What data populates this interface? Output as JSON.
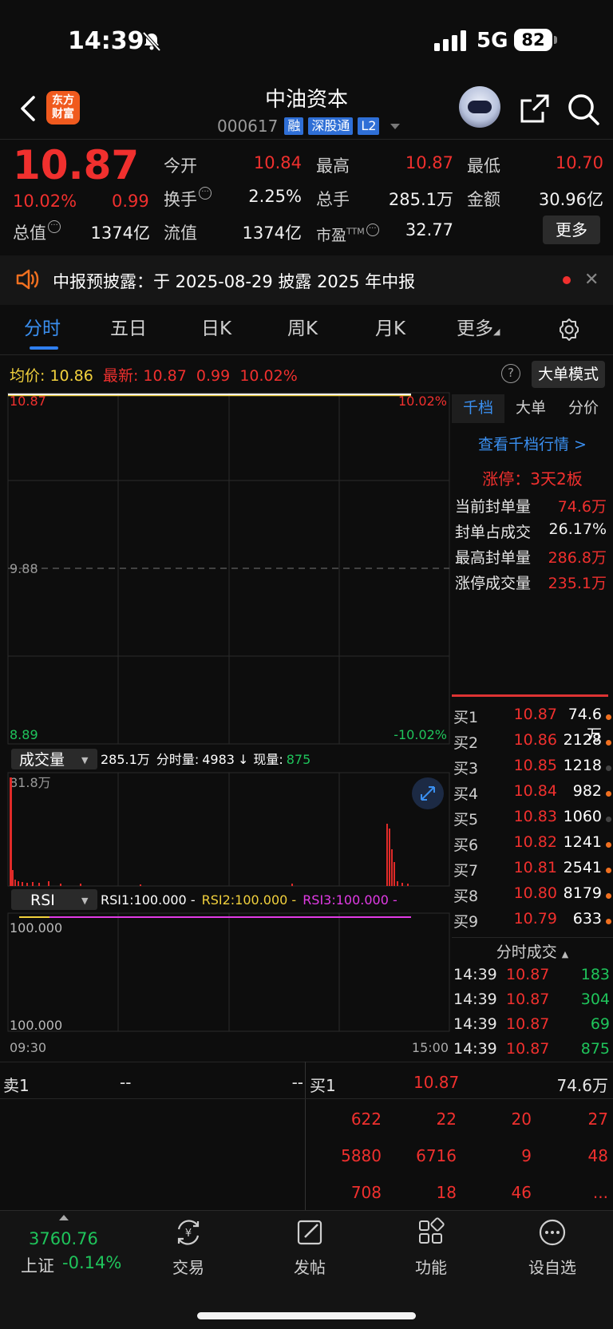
{
  "status_bar": {
    "time": "14:39",
    "network": "5G",
    "battery": "82"
  },
  "header": {
    "logo_line1": "东方",
    "logo_line2": "财富",
    "stock_name": "中油资本",
    "stock_code": "000617",
    "tags": [
      "融",
      "深股通",
      "L2"
    ]
  },
  "quote": {
    "price": "10.87",
    "change_pct": "10.02%",
    "change": "0.99",
    "stats": [
      {
        "label": "今开",
        "value": "10.84",
        "color": "red"
      },
      {
        "label": "最高",
        "value": "10.87",
        "color": "red"
      },
      {
        "label": "最低",
        "value": "10.70",
        "color": "red"
      },
      {
        "label": "换手",
        "value": "2.25%",
        "color": "white"
      },
      {
        "label": "总手",
        "value": "285.1万",
        "color": "white"
      },
      {
        "label": "金额",
        "value": "30.96亿",
        "color": "white"
      },
      {
        "label": "总值",
        "value": "1374亿",
        "color": "white"
      },
      {
        "label": "流值",
        "value": "1374亿",
        "color": "white"
      },
      {
        "label": "市盈",
        "value": "32.77",
        "color": "white"
      }
    ],
    "pe_superscript": "TTM",
    "more_label": "更多"
  },
  "notice": {
    "text": "中报预披露：于 2025-08-29 披露 2025 年中报"
  },
  "tabs": [
    "分时",
    "五日",
    "日K",
    "周K",
    "月K",
    "更多"
  ],
  "chart_info": {
    "avg_label": "均价:",
    "avg_value": "10.86",
    "latest_label": "最新:",
    "latest_price": "10.87",
    "latest_change": "0.99",
    "latest_pct": "10.02%",
    "help": "?",
    "big_order_mode": "大单模式"
  },
  "chart_data": {
    "type": "line",
    "title": "",
    "price_axis": {
      "top": "10.87",
      "mid": "9.88",
      "bottom": "8.89"
    },
    "pct_axis": {
      "top": "10.02%",
      "bottom": "-10.02%"
    },
    "x_labels": {
      "start": "09:30",
      "end": "15:00"
    },
    "series": [
      {
        "name": "均价",
        "color": "#f2d13d",
        "values": [
          10.86,
          10.86
        ]
      },
      {
        "name": "最新",
        "color": "#f0f0f0",
        "values": [
          10.87,
          10.87
        ]
      }
    ],
    "volume": {
      "label": "成交量",
      "total": "285.1万",
      "minute_label": "分时量:",
      "minute_value": "4983",
      "arrow": "↓",
      "current_label": "现量:",
      "current_value": "875",
      "max_label": "81.8万"
    },
    "rsi": {
      "label": "RSI",
      "rsi1": "RSI1:100.000 -",
      "rsi2": "RSI2:100.000 -",
      "rsi3": "RSI3:100.000 -",
      "top": "100.000",
      "bottom": "100.000"
    }
  },
  "right_panel": {
    "tabs": [
      "千档",
      "大单",
      "分价"
    ],
    "view_link": "查看千档行情 >",
    "limit_up": "涨停：3天2板",
    "stats": [
      {
        "label": "当前封单量",
        "value": "74.6万",
        "color": "red"
      },
      {
        "label": "封单占成交",
        "value": "26.17%",
        "color": "white"
      },
      {
        "label": "最高封单量",
        "value": "286.8万",
        "color": "red"
      },
      {
        "label": "涨停成交量",
        "value": "235.1万",
        "color": "red"
      }
    ],
    "bids": [
      {
        "label": "买1",
        "price": "10.87",
        "vol": "74.6万",
        "dot": "orange"
      },
      {
        "label": "买2",
        "price": "10.86",
        "vol": "2128",
        "dot": "orange"
      },
      {
        "label": "买3",
        "price": "10.85",
        "vol": "1218",
        "dot": "gray"
      },
      {
        "label": "买4",
        "price": "10.84",
        "vol": "982",
        "dot": "orange"
      },
      {
        "label": "买5",
        "price": "10.83",
        "vol": "1060",
        "dot": "gray"
      },
      {
        "label": "买6",
        "price": "10.82",
        "vol": "1241",
        "dot": "orange"
      },
      {
        "label": "买7",
        "price": "10.81",
        "vol": "2541",
        "dot": "orange"
      },
      {
        "label": "买8",
        "price": "10.80",
        "vol": "8179",
        "dot": "orange"
      },
      {
        "label": "买9",
        "price": "10.79",
        "vol": "633",
        "dot": "orange"
      }
    ],
    "ticks_title": "分时成交",
    "ticks": [
      {
        "time": "14:39",
        "price": "10.87",
        "vol": "183"
      },
      {
        "time": "14:39",
        "price": "10.87",
        "vol": "304"
      },
      {
        "time": "14:39",
        "price": "10.87",
        "vol": "69"
      },
      {
        "time": "14:39",
        "price": "10.87",
        "vol": "875"
      }
    ]
  },
  "order_summary": {
    "sell_label": "卖1",
    "sell_price": "--",
    "sell_vol": "--",
    "buy_label": "买1",
    "buy_price": "10.87",
    "buy_vol": "74.6万",
    "rows": [
      [
        "622",
        "22",
        "20",
        "27"
      ],
      [
        "5880",
        "6716",
        "9",
        "48"
      ],
      [
        "708",
        "18",
        "46",
        "..."
      ]
    ]
  },
  "bottom_nav": {
    "index_value": "3760.76",
    "index_name": "上证",
    "index_change": "-0.14%",
    "items": [
      {
        "label": "交易",
        "icon": "yen-cycle-icon"
      },
      {
        "label": "发帖",
        "icon": "edit-icon"
      },
      {
        "label": "功能",
        "icon": "grid-icon"
      },
      {
        "label": "设自选",
        "icon": "more-circle-icon"
      }
    ]
  }
}
